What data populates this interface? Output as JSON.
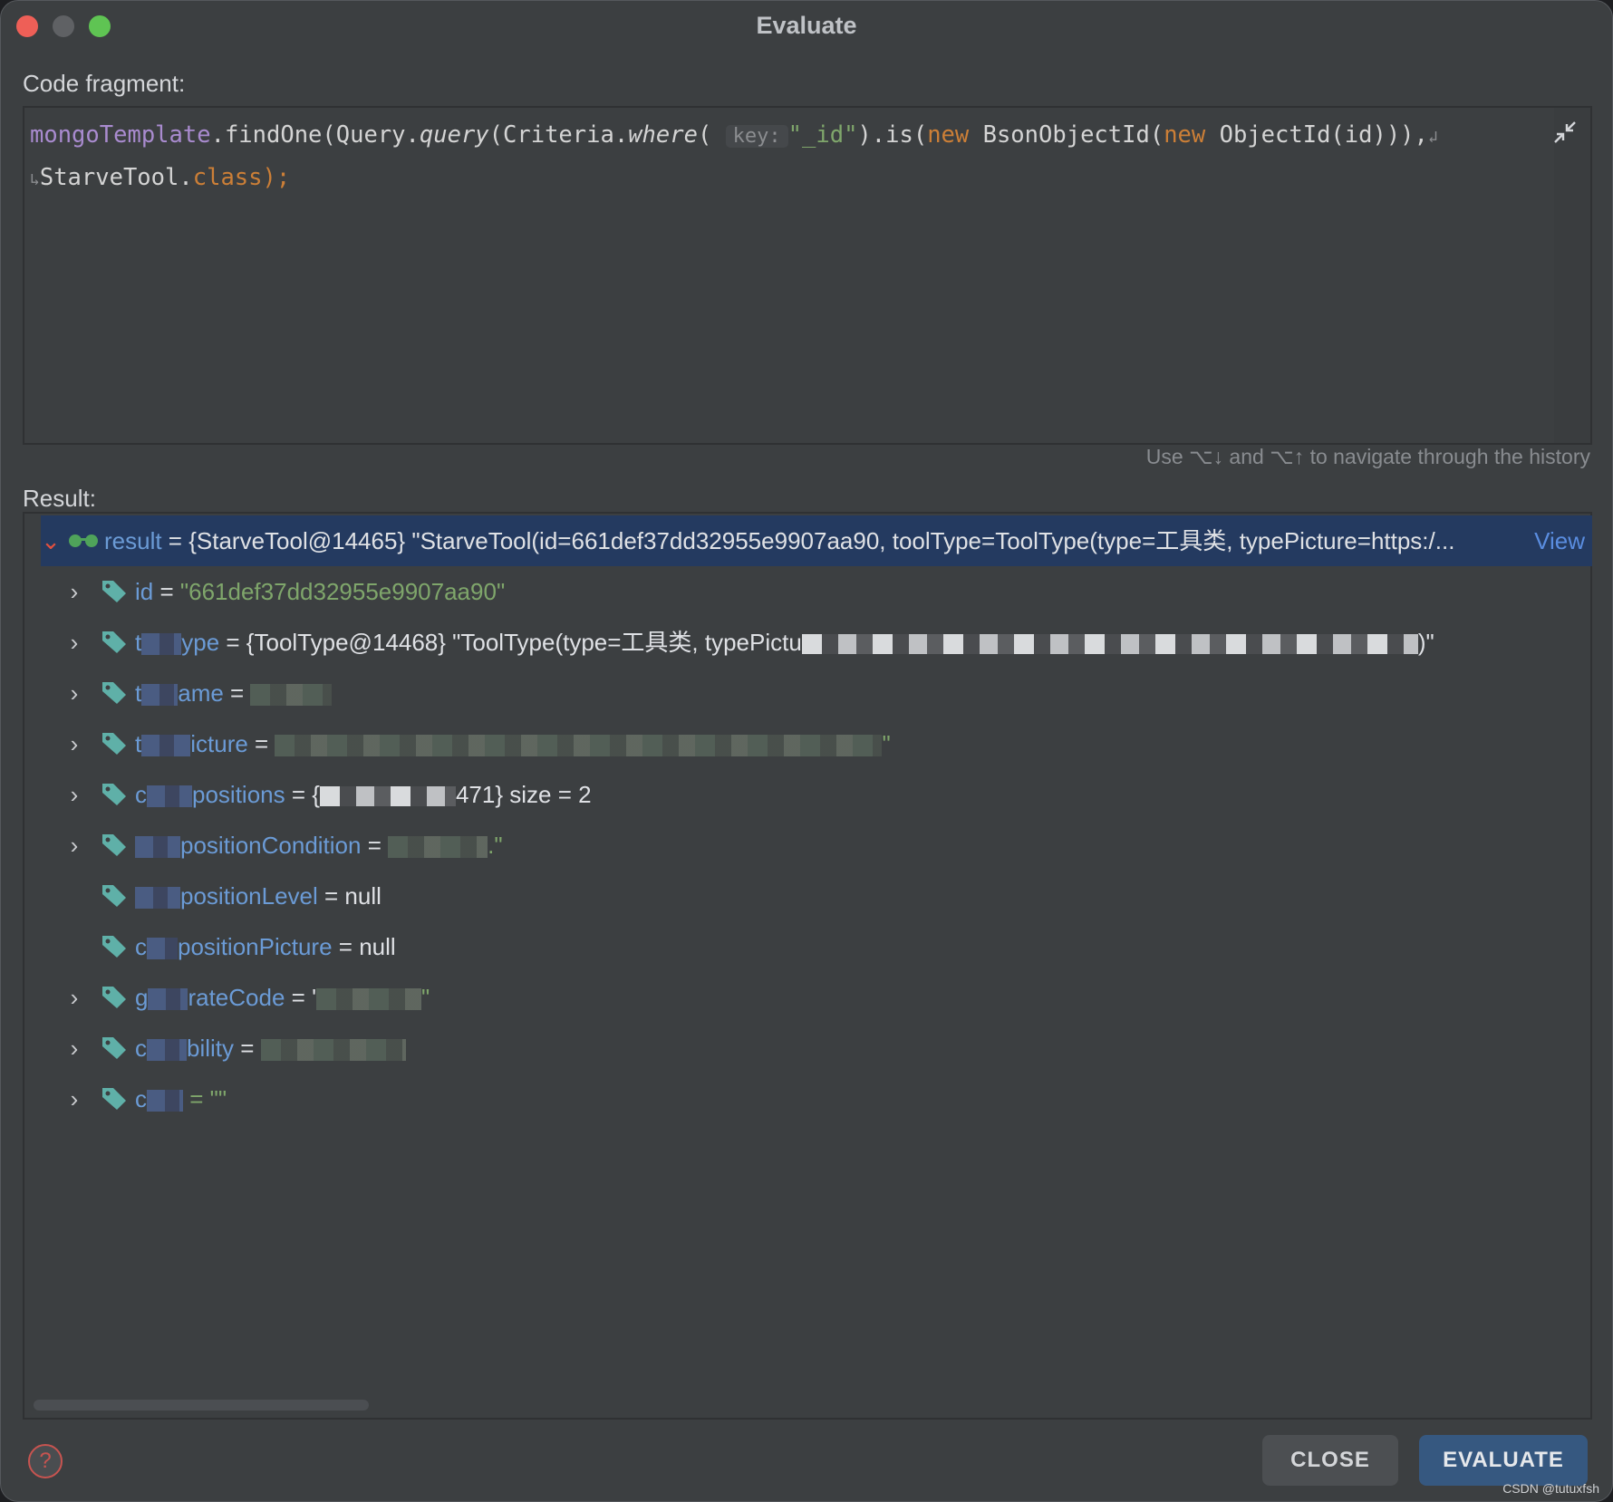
{
  "window": {
    "title": "Evaluate"
  },
  "code_fragment": {
    "label": "Code fragment:",
    "line1": {
      "field": "mongoTemplate",
      "p1": ".findOne(Query.",
      "m1": "query",
      "p2": "(Criteria.",
      "m2": "where",
      "p3": "( ",
      "hint": "key:",
      "str": "\"_id\"",
      "p4": ").is(",
      "kw1": "new",
      "p5": " BsonObjectId(",
      "kw2": "new",
      "p6": " ObjectId(id))),",
      "wrap": "↲"
    },
    "line2": {
      "wrap": "↳",
      "p1": "StarveTool.",
      "kw": "class",
      "p2": ");"
    },
    "history_hint": "Use ⌥↓ and ⌥↑ to navigate through the history"
  },
  "result": {
    "label": "Result:",
    "root": {
      "name": "result",
      "value": " = {StarveTool@14465} \"StarveTool(id=661def37dd32955e9907aa90, toolType=ToolType(type=工具类, typePicture=https:/...",
      "view_label": "View"
    },
    "rows": [
      {
        "name": "id",
        "value": "\"661def37dd32955e9907aa90\""
      },
      {
        "name_a": "t",
        "name_b": "ype",
        "value": "= {ToolType@14468} \"ToolType(type=工具类, typePictu",
        "tail": ")\""
      },
      {
        "name_a": "t",
        "name_b": "ame",
        "value": "="
      },
      {
        "name_a": "t",
        "name_b": "icture",
        "value": "=",
        "tail": "\""
      },
      {
        "name_a": "c",
        "name_b": "positions",
        "value": "= {",
        "mid": "471}  size = 2"
      },
      {
        "name_b": "positionCondition",
        "value": "=",
        "tail": ".\""
      },
      {
        "name_b": "positionLevel",
        "value": "= null"
      },
      {
        "name_a": "c",
        "name_b": "positionPicture",
        "value": "= null"
      },
      {
        "name_a": "g",
        "name_b": "rateCode",
        "value": "= '",
        "tail": "\""
      },
      {
        "name_a": "c",
        "name_b": "bility",
        "value": "="
      },
      {
        "name_a": "c",
        "value": "= \"\""
      }
    ]
  },
  "buttons": {
    "close": "CLOSE",
    "evaluate": "EVALUATE",
    "help": "?"
  },
  "watermark": "CSDN @tutuxfsh"
}
